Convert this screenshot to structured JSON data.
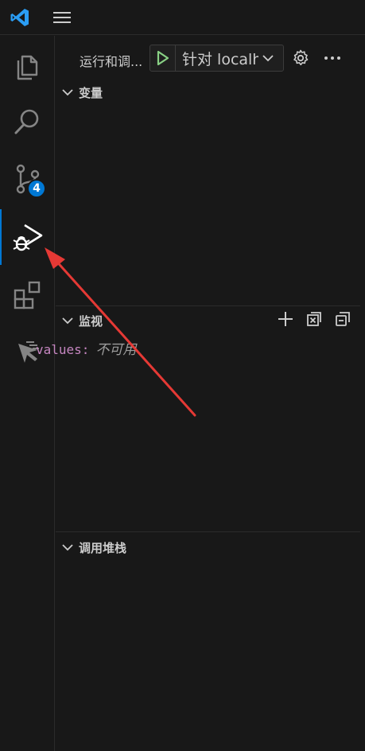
{
  "titlebar": {
    "logo_icon": "vscode-logo-icon",
    "menu_icon": "hamburger-menu-icon"
  },
  "activity_bar": {
    "items": [
      {
        "name": "explorer",
        "icon": "files-icon"
      },
      {
        "name": "search",
        "icon": "search-icon"
      },
      {
        "name": "source-control",
        "icon": "source-control-icon",
        "badge": "4"
      },
      {
        "name": "run-and-debug",
        "icon": "run-debug-icon",
        "active": true
      },
      {
        "name": "extensions",
        "icon": "extensions-icon"
      },
      {
        "name": "remote",
        "icon": "cursor-icon"
      }
    ]
  },
  "debug_toolbar": {
    "title": "运行和调...",
    "config_name": "针对 localh",
    "play_icon": "play-icon",
    "dropdown_icon": "chevron-down-icon",
    "settings_icon": "gear-icon",
    "more_icon": "ellipsis-icon"
  },
  "sections": {
    "variables": {
      "label": "变量"
    },
    "watch": {
      "label": "监视",
      "items": [
        {
          "name": "values:",
          "value": "不可用"
        }
      ]
    },
    "callstack": {
      "label": "调用堆栈"
    }
  },
  "colors": {
    "accent": "#0078d4",
    "play_green": "#89d185",
    "watch_name": "#c586c0",
    "annotation_arrow": "#e53935"
  }
}
